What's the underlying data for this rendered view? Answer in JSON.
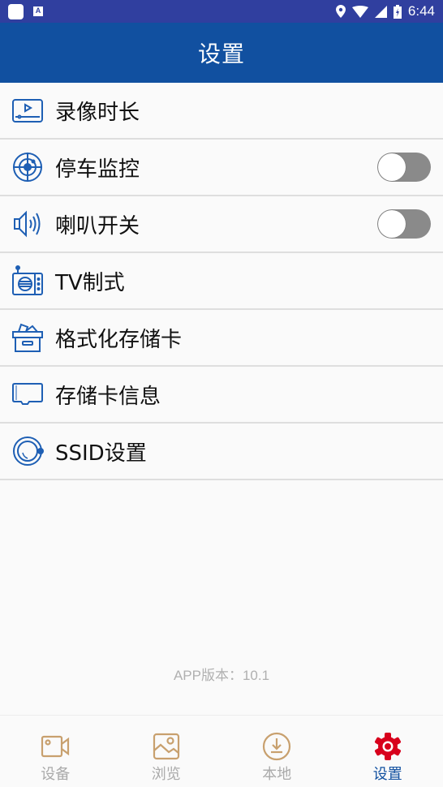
{
  "status_bar": {
    "time": "6:44",
    "icons": [
      "app-icon",
      "a-icon",
      "location-icon",
      "wifi-icon",
      "signal-icon",
      "battery-charging-icon"
    ]
  },
  "app_bar": {
    "title": "设置"
  },
  "colors": {
    "primary": "#1150a0",
    "status_bar": "#303f9f",
    "icon_blue": "#1e5fb4",
    "nav_inactive": "#c8a06e",
    "nav_active_icon": "#d8001c",
    "toggle_off": "#8a8a8a"
  },
  "settings": [
    {
      "label": "录像时长",
      "icon": "video-duration-icon"
    },
    {
      "label": "停车监控",
      "icon": "parking-monitor-icon",
      "toggle": "off"
    },
    {
      "label": "喇叭开关",
      "icon": "speaker-icon",
      "toggle": "off"
    },
    {
      "label": "TV制式",
      "icon": "tv-icon"
    },
    {
      "label": "格式化存储卡",
      "icon": "format-box-icon"
    },
    {
      "label": "存储卡信息",
      "icon": "sd-card-icon"
    },
    {
      "label": "SSID设置",
      "icon": "ssid-icon"
    }
  ],
  "version": "APP版本：10.1",
  "bottom_nav": [
    {
      "label": "设备",
      "icon": "camera-icon",
      "active": false
    },
    {
      "label": "浏览",
      "icon": "gallery-icon",
      "active": false
    },
    {
      "label": "本地",
      "icon": "download-icon",
      "active": false
    },
    {
      "label": "设置",
      "icon": "gear-icon",
      "active": true
    }
  ]
}
